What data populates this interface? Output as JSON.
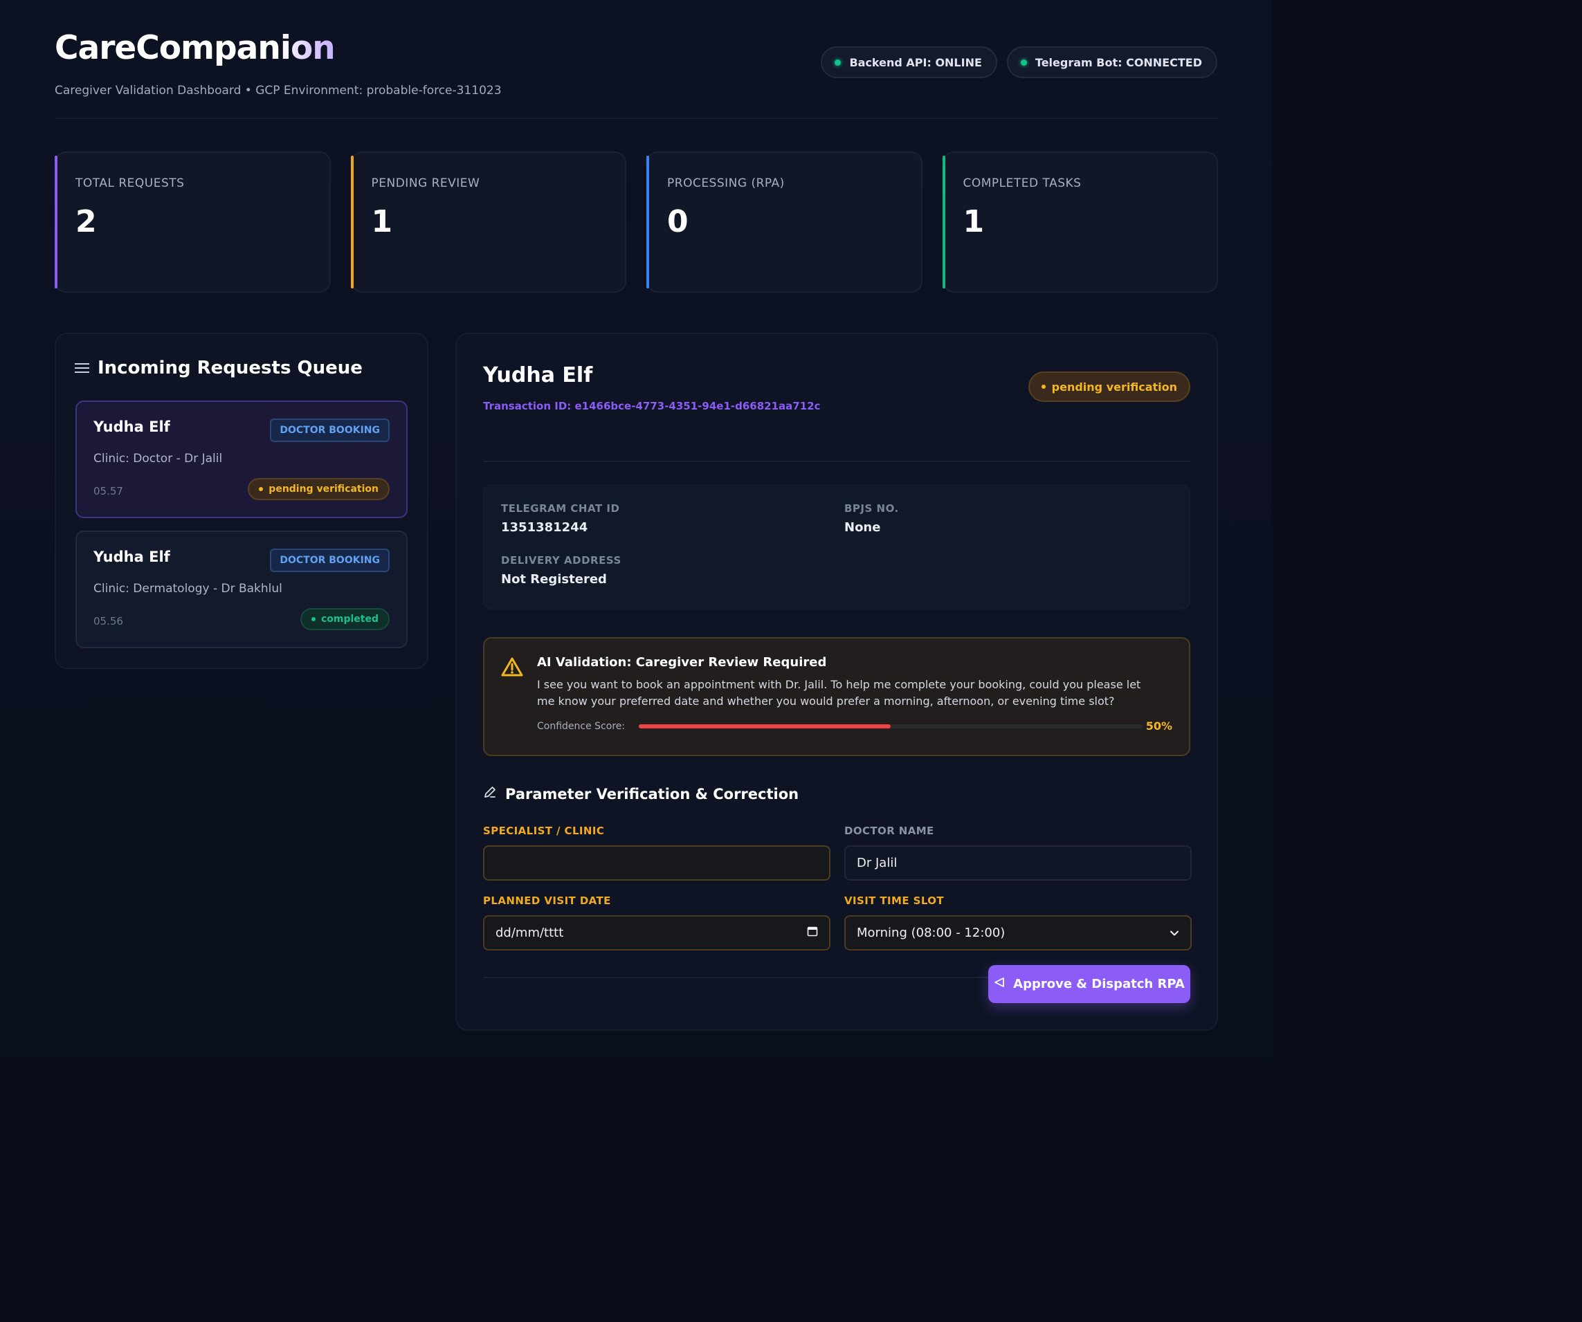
{
  "header": {
    "brand_part1": "CareCompan",
    "brand_part2": "ion",
    "subtitle": "Caregiver Validation Dashboard • GCP Environment: probable-force-311023",
    "statuses": [
      {
        "label": "Backend API: ONLINE",
        "color": "#10c48a"
      },
      {
        "label": "Telegram Bot: CONNECTED",
        "color": "#10c48a"
      }
    ]
  },
  "stats": [
    {
      "label": "TOTAL REQUESTS",
      "value": "2",
      "accent": "#8b5cf6"
    },
    {
      "label": "PENDING REVIEW",
      "value": "1",
      "accent": "#f0a516"
    },
    {
      "label": "PROCESSING (RPA)",
      "value": "0",
      "accent": "#3b82f6"
    },
    {
      "label": "COMPLETED TASKS",
      "value": "1",
      "accent": "#10b981"
    }
  ],
  "queue": {
    "title": "Incoming Requests Queue",
    "icon": "list-icon",
    "items": [
      {
        "name": "Yudha Elf",
        "type": "DOCTOR BOOKING",
        "clinic": "Clinic: Doctor - Dr Jalil",
        "time": "05.57",
        "status": "pending verification"
      },
      {
        "name": "Yudha Elf",
        "type": "DOCTOR BOOKING",
        "clinic": "Clinic: Dermatology - Dr Bakhlul",
        "time": "05.56",
        "status": "completed"
      }
    ]
  },
  "detail": {
    "name": "Yudha Elf",
    "transaction_id": "Transaction ID: e1466bce-4773-4351-94e1-d66821aa712c",
    "status": "pending verification",
    "info": {
      "telegram_label": "TELEGRAM CHAT ID",
      "telegram_value": "1351381244",
      "bpjs_label": "BPJS NO.",
      "bpjs_value": "None",
      "address_label": "DELIVERY ADDRESS",
      "address_value": "Not Registered"
    },
    "ai": {
      "icon": "warning-icon",
      "title": "AI Validation: Caregiver Review Required",
      "text": "I see you want to book an appointment with Dr. Jalil. To help me complete your booking, could you please let me know your preferred date and whether you would prefer a morning, afternoon, or evening time slot?",
      "confidence_label": "Confidence Score:",
      "confidence_value": "50%",
      "confidence_fraction": 0.5
    },
    "params": {
      "title": "Parameter Verification & Correction",
      "icon": "pencil-icon",
      "specialist_label": "SPECIALIST / CLINIC",
      "specialist_value": "",
      "doctor_label": "DOCTOR NAME",
      "doctor_value": "Dr Jalil",
      "date_label": "PLANNED VISIT DATE",
      "date_placeholder": "dd/mm/tttt",
      "slot_label": "VISIT TIME SLOT",
      "slot_value": "Morning (08:00 - 12:00)"
    },
    "approve_label": "Approve & Dispatch RPA"
  }
}
